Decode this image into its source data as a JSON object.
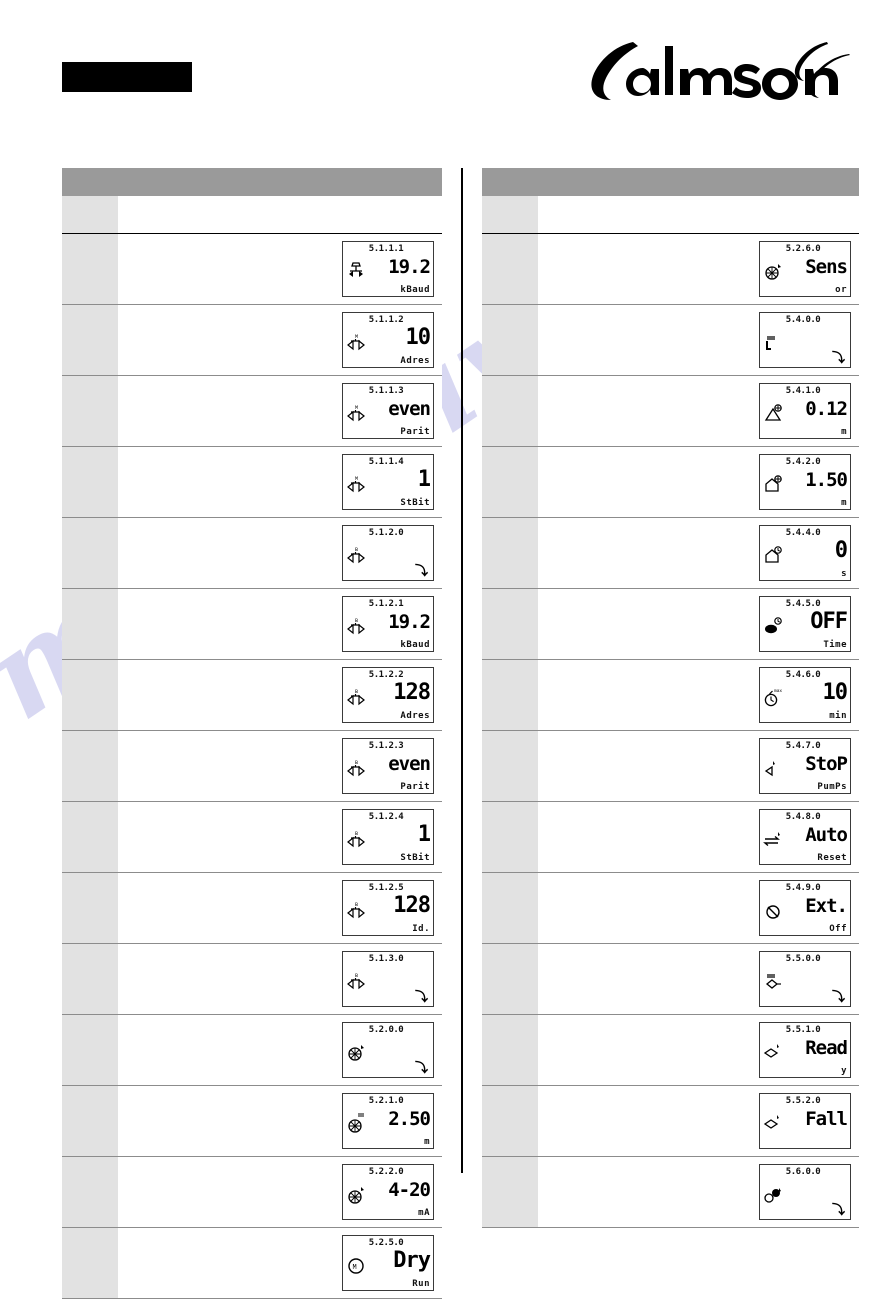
{
  "header": {
    "redacted_bar": "",
    "brand": "Salmson"
  },
  "watermark": {
    "text": "manualive.com"
  },
  "columns": [
    {
      "name": "left",
      "header_label": "",
      "intro_row": {
        "text": ""
      },
      "rows": [
        {
          "text": "",
          "lcd": {
            "code": "5.1.1.1",
            "icon": "bus-terminator-icon",
            "value": "19.2",
            "unit": "kBaud",
            "arrow": ""
          }
        },
        {
          "text": "",
          "lcd": {
            "code": "5.1.1.2",
            "icon": "bus-terminator-m-icon",
            "value": "10",
            "unit": "Adres",
            "arrow": ""
          }
        },
        {
          "text": "",
          "lcd": {
            "code": "5.1.1.3",
            "icon": "bus-terminator-m-icon",
            "value": "even",
            "unit": "Parit",
            "arrow": ""
          }
        },
        {
          "text": "",
          "lcd": {
            "code": "5.1.1.4",
            "icon": "bus-terminator-m-icon",
            "value": "1",
            "unit": "StBit",
            "arrow": ""
          }
        },
        {
          "text": "",
          "lcd": {
            "code": "5.1.2.0",
            "icon": "bus-terminator-b-icon",
            "value": "",
            "unit": "",
            "arrow": "submenu-arrow"
          }
        },
        {
          "text": "",
          "lcd": {
            "code": "5.1.2.1",
            "icon": "bus-terminator-b-icon",
            "value": "19.2",
            "unit": "kBaud",
            "arrow": ""
          }
        },
        {
          "text": "",
          "lcd": {
            "code": "5.1.2.2",
            "icon": "bus-terminator-b-icon",
            "value": "128",
            "unit": "Adres",
            "arrow": ""
          }
        },
        {
          "text": "",
          "lcd": {
            "code": "5.1.2.3",
            "icon": "bus-terminator-b-icon",
            "value": "even",
            "unit": "Parit",
            "arrow": ""
          }
        },
        {
          "text": "",
          "lcd": {
            "code": "5.1.2.4",
            "icon": "bus-terminator-b-icon",
            "value": "1",
            "unit": "StBit",
            "arrow": ""
          }
        },
        {
          "text": "",
          "lcd": {
            "code": "5.1.2.5",
            "icon": "bus-terminator-b-icon",
            "value": "128",
            "unit": "Id.",
            "arrow": ""
          }
        },
        {
          "text": "",
          "lcd": {
            "code": "5.1.3.0",
            "icon": "bus-terminator-b-icon",
            "value": "",
            "unit": "",
            "arrow": "submenu-arrow"
          }
        },
        {
          "text": "",
          "lcd": {
            "code": "5.2.0.0",
            "icon": "sensor-icon",
            "value": "",
            "unit": "",
            "arrow": "submenu-arrow"
          }
        },
        {
          "text": "",
          "lcd": {
            "code": "5.2.1.0",
            "icon": "sensor-range-icon",
            "value": "2.50",
            "unit": "m",
            "arrow": ""
          }
        },
        {
          "text": "",
          "lcd": {
            "code": "5.2.2.0",
            "icon": "sensor-signal-icon",
            "value": "4-20",
            "unit": "mA",
            "arrow": ""
          }
        },
        {
          "text": "",
          "lcd": {
            "code": "5.2.5.0",
            "icon": "dryrun-icon",
            "value": "Dry",
            "unit": "Run",
            "arrow": ""
          }
        }
      ]
    },
    {
      "name": "right",
      "header_label": "",
      "intro_row": {
        "text": ""
      },
      "rows": [
        {
          "text": "",
          "lcd": {
            "code": "5.2.6.0",
            "icon": "sensor-icon",
            "value": "Sens",
            "unit": "or",
            "arrow": ""
          }
        },
        {
          "text": "",
          "lcd": {
            "code": "5.4.0.0",
            "icon": "level-control-icon",
            "value": "",
            "unit": "",
            "arrow": "submenu-arrow"
          }
        },
        {
          "text": "",
          "lcd": {
            "code": "5.4.1.0",
            "icon": "level-low-icon",
            "value": "0.12",
            "unit": "m",
            "arrow": ""
          }
        },
        {
          "text": "",
          "lcd": {
            "code": "5.4.2.0",
            "icon": "level-high-icon",
            "value": "1.50",
            "unit": "m",
            "arrow": ""
          }
        },
        {
          "text": "",
          "lcd": {
            "code": "5.4.4.0",
            "icon": "level-delay-icon",
            "value": "0",
            "unit": "s",
            "arrow": ""
          }
        },
        {
          "text": "",
          "lcd": {
            "code": "5.4.5.0",
            "icon": "pump-off-icon",
            "value": "OFF",
            "unit": "Time",
            "arrow": ""
          }
        },
        {
          "text": "",
          "lcd": {
            "code": "5.4.6.0",
            "icon": "max-timer-icon",
            "value": "10",
            "unit": "min",
            "arrow": ""
          }
        },
        {
          "text": "",
          "lcd": {
            "code": "5.4.7.0",
            "icon": "stop-pumps-icon",
            "value": "StoP",
            "unit": "PumPs",
            "arrow": ""
          }
        },
        {
          "text": "",
          "lcd": {
            "code": "5.4.8.0",
            "icon": "auto-reset-icon",
            "value": "Auto",
            "unit": "Reset",
            "arrow": ""
          }
        },
        {
          "text": "",
          "lcd": {
            "code": "5.4.9.0",
            "icon": "ext-off-icon",
            "value": "Ext.",
            "unit": "Off",
            "arrow": ""
          }
        },
        {
          "text": "",
          "lcd": {
            "code": "5.5.0.0",
            "icon": "relay-config-icon",
            "value": "",
            "unit": "",
            "arrow": "submenu-arrow"
          }
        },
        {
          "text": "",
          "lcd": {
            "code": "5.5.1.0",
            "icon": "relay-ready-icon",
            "value": "Read",
            "unit": "y",
            "arrow": ""
          }
        },
        {
          "text": "",
          "lcd": {
            "code": "5.5.2.0",
            "icon": "relay-fall-icon",
            "value": "Fall",
            "unit": "",
            "arrow": ""
          }
        },
        {
          "text": "",
          "lcd": {
            "code": "5.6.0.0",
            "icon": "pumps-group-icon",
            "value": "",
            "unit": "",
            "arrow": "submenu-arrow"
          }
        }
      ]
    }
  ],
  "colors": {
    "header_gray": "#9a9a9a",
    "code_cell_gray": "#e2e2e2",
    "rule": "#8c8c8c",
    "watermark": "#b9b9e8"
  }
}
